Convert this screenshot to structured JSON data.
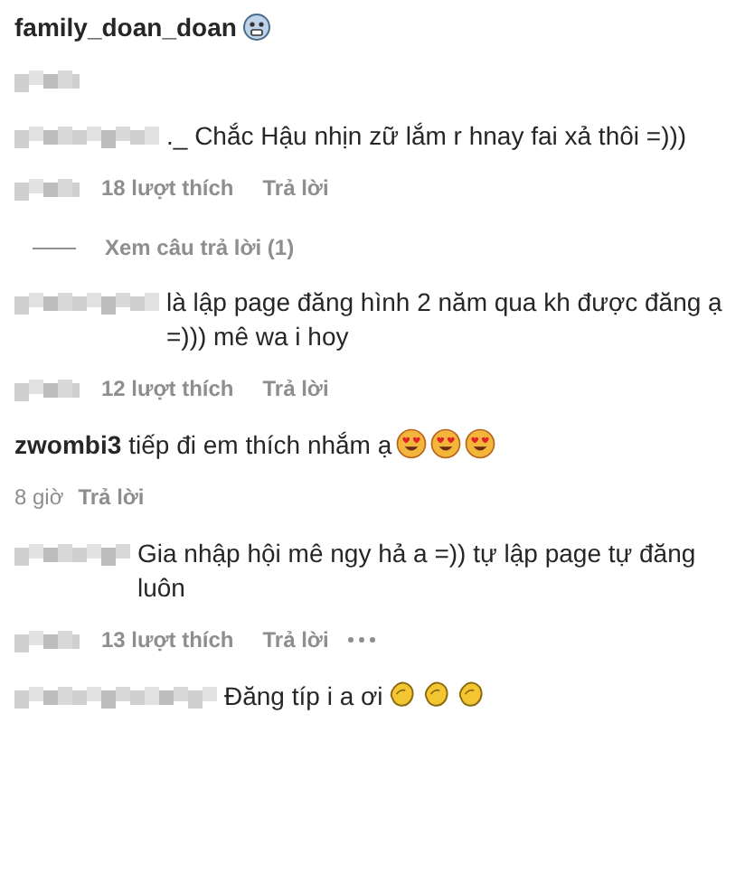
{
  "comments": [
    {
      "author": "family_doan_doan",
      "emojis": [
        {
          "kind": "fearful"
        }
      ]
    },
    {
      "text": "._ Chắc Hậu nhịn zữ lắm r hnay fai xả thôi =)))",
      "likes": "18 lượt thích",
      "reply": "Trả lời",
      "view_replies": "Xem câu trả lời (1)"
    },
    {
      "text": "là lập page đăng hình 2 năm qua kh được đăng ạ =))) mê wa i hoy",
      "likes": "12 lượt thích",
      "reply": "Trả lời"
    },
    {
      "author": "zwombi3",
      "text": "tiếp đi em thích nhắm ạ",
      "emojis": [
        {
          "kind": "heart-eyes"
        },
        {
          "kind": "heart-eyes"
        },
        {
          "kind": "heart-eyes"
        }
      ],
      "time": "8 giờ",
      "reply": "Trả lời"
    },
    {
      "text": "Gia nhập hội mê ngy hả a =)) tự lập page tự đăng luôn",
      "likes": "13 lượt thích",
      "reply": "Trả lời",
      "more": true
    },
    {
      "text": "Đăng típ i a ơi",
      "emojis": [
        {
          "kind": "clap"
        },
        {
          "kind": "clap"
        },
        {
          "kind": "clap"
        }
      ],
      "no_meta": true
    }
  ]
}
